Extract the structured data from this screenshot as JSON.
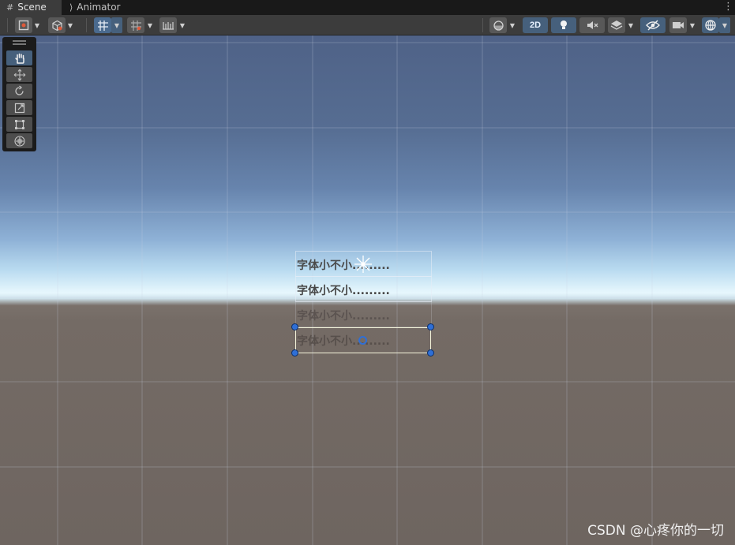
{
  "tabs": [
    {
      "label": "Scene",
      "icon": "grid-icon"
    },
    {
      "label": "Animator",
      "icon": "animator-icon"
    }
  ],
  "toolbar": {
    "mode_2d_label": "2D",
    "buttons": [
      "draw-mode",
      "shading-mode",
      "grid-snapping",
      "incremental-snap",
      "ruler",
      "shading",
      "2d",
      "lighting",
      "audio",
      "effects",
      "hidden-objects",
      "camera",
      "gizmos"
    ]
  },
  "tools": [
    "hand",
    "move",
    "rotate",
    "scale",
    "rect",
    "transform"
  ],
  "ui_rows": [
    {
      "text": "字体小不小.........",
      "bold": true
    },
    {
      "text": "字体小不小.........",
      "bold": true
    },
    {
      "text": "字体小不小.........",
      "bold": true
    },
    {
      "text": "字体小不小.........",
      "bold": true
    }
  ],
  "watermark": "CSDN @心疼你的一切",
  "colors": {
    "accent": "#46607c",
    "handle": "#2f6fd6",
    "text_dark": "#3b3b3b"
  }
}
